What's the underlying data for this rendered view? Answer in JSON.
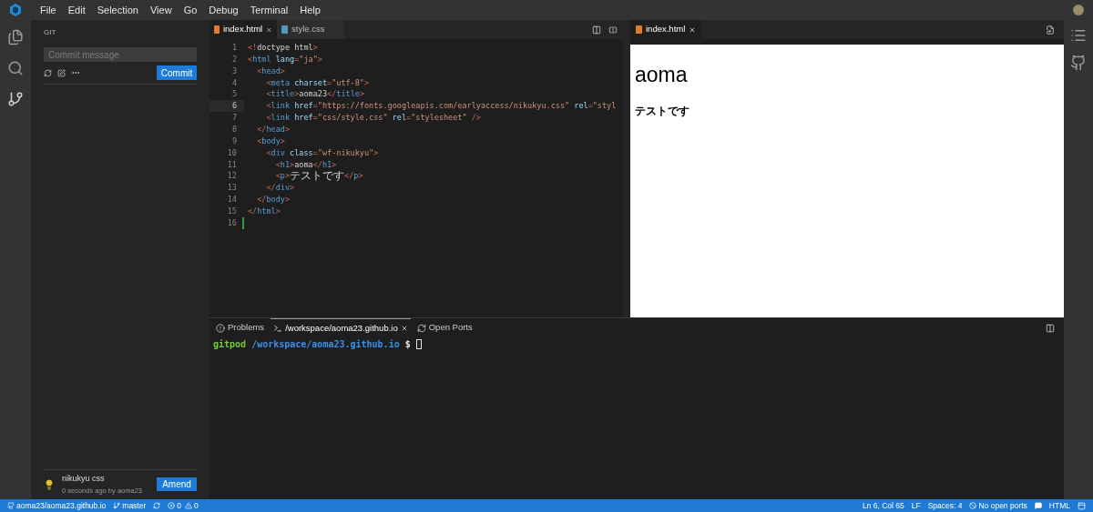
{
  "menu": [
    "File",
    "Edit",
    "Selection",
    "View",
    "Go",
    "Debug",
    "Terminal",
    "Help"
  ],
  "git": {
    "title": "GIT",
    "commit_placeholder": "Commit message",
    "commit_button": "Commit",
    "last_commit": {
      "message": "nikukyu css",
      "meta": "0 seconds ago by aoma23"
    },
    "amend_button": "Amend"
  },
  "editor_tabs": [
    {
      "label": "index.html",
      "selected": true,
      "kind": "html",
      "closable": true
    },
    {
      "label": "style.css",
      "selected": false,
      "kind": "css",
      "closable": false
    }
  ],
  "code_lines": [
    {
      "number": "1",
      "highlighted": false,
      "added": false,
      "tokens": [
        {
          "kind": "punct",
          "text": "<!"
        },
        {
          "kind": "plain",
          "text": "doctype html"
        },
        {
          "kind": "punct",
          "text": ">"
        }
      ]
    },
    {
      "number": "2",
      "highlighted": false,
      "added": false,
      "tokens": [
        {
          "kind": "punct",
          "text": "<"
        },
        {
          "kind": "tag",
          "text": "html "
        },
        {
          "kind": "attr",
          "text": "lang"
        },
        {
          "kind": "punct",
          "text": "="
        },
        {
          "kind": "str",
          "text": "\"ja\""
        },
        {
          "kind": "punct",
          "text": ">"
        }
      ]
    },
    {
      "number": "3",
      "highlighted": false,
      "added": false,
      "tokens": [
        {
          "kind": "punct",
          "text": "  <"
        },
        {
          "kind": "tag",
          "text": "head"
        },
        {
          "kind": "punct",
          "text": ">"
        }
      ]
    },
    {
      "number": "4",
      "highlighted": false,
      "added": false,
      "tokens": [
        {
          "kind": "punct",
          "text": "    <"
        },
        {
          "kind": "tag",
          "text": "meta "
        },
        {
          "kind": "attr",
          "text": "charset"
        },
        {
          "kind": "punct",
          "text": "="
        },
        {
          "kind": "str",
          "text": "\"utf-8\""
        },
        {
          "kind": "punct",
          "text": ">"
        }
      ]
    },
    {
      "number": "5",
      "highlighted": false,
      "added": false,
      "tokens": [
        {
          "kind": "punct",
          "text": "    <"
        },
        {
          "kind": "tag",
          "text": "title"
        },
        {
          "kind": "punct",
          "text": ">"
        },
        {
          "kind": "plain",
          "text": "aoma23"
        },
        {
          "kind": "punct",
          "text": "</"
        },
        {
          "kind": "tag",
          "text": "title"
        },
        {
          "kind": "punct",
          "text": ">"
        }
      ]
    },
    {
      "number": "6",
      "highlighted": true,
      "added": false,
      "tokens": [
        {
          "kind": "punct",
          "text": "    <"
        },
        {
          "kind": "tag",
          "text": "link "
        },
        {
          "kind": "attr",
          "text": "href"
        },
        {
          "kind": "punct",
          "text": "="
        },
        {
          "kind": "str",
          "text": "\"https://fonts.googleapis.com/earlyaccess/nikukyu.css\" "
        },
        {
          "kind": "attr",
          "text": "rel"
        },
        {
          "kind": "punct",
          "text": "="
        },
        {
          "kind": "str",
          "text": "\"styl"
        }
      ]
    },
    {
      "number": "7",
      "highlighted": false,
      "added": false,
      "tokens": [
        {
          "kind": "punct",
          "text": "    <"
        },
        {
          "kind": "tag",
          "text": "link "
        },
        {
          "kind": "attr",
          "text": "href"
        },
        {
          "kind": "punct",
          "text": "="
        },
        {
          "kind": "str",
          "text": "\"css/style.css\" "
        },
        {
          "kind": "attr",
          "text": "rel"
        },
        {
          "kind": "punct",
          "text": "="
        },
        {
          "kind": "str",
          "text": "\"stylesheet\" "
        },
        {
          "kind": "punct",
          "text": "/>"
        }
      ]
    },
    {
      "number": "8",
      "highlighted": false,
      "added": false,
      "tokens": [
        {
          "kind": "punct",
          "text": "  </"
        },
        {
          "kind": "tag",
          "text": "head"
        },
        {
          "kind": "punct",
          "text": ">"
        }
      ]
    },
    {
      "number": "9",
      "highlighted": false,
      "added": false,
      "tokens": [
        {
          "kind": "punct",
          "text": "  <"
        },
        {
          "kind": "tag",
          "text": "body"
        },
        {
          "kind": "punct",
          "text": ">"
        }
      ]
    },
    {
      "number": "10",
      "highlighted": false,
      "added": false,
      "tokens": [
        {
          "kind": "punct",
          "text": "    <"
        },
        {
          "kind": "tag",
          "text": "div "
        },
        {
          "kind": "attr",
          "text": "class"
        },
        {
          "kind": "punct",
          "text": "="
        },
        {
          "kind": "str",
          "text": "\"wf-nikukyu\""
        },
        {
          "kind": "punct",
          "text": ">"
        }
      ]
    },
    {
      "number": "11",
      "highlighted": false,
      "added": false,
      "tokens": [
        {
          "kind": "punct",
          "text": "      <"
        },
        {
          "kind": "tag",
          "text": "h1"
        },
        {
          "kind": "punct",
          "text": ">"
        },
        {
          "kind": "plain",
          "text": "aoma"
        },
        {
          "kind": "punct",
          "text": "</"
        },
        {
          "kind": "tag",
          "text": "h1"
        },
        {
          "kind": "punct",
          "text": ">"
        }
      ]
    },
    {
      "number": "12",
      "highlighted": false,
      "added": false,
      "tokens": [
        {
          "kind": "punct",
          "text": "      <"
        },
        {
          "kind": "tag",
          "text": "p"
        },
        {
          "kind": "punct",
          "text": ">"
        },
        {
          "kind": "cjk",
          "text": "テストです"
        },
        {
          "kind": "punct",
          "text": "</"
        },
        {
          "kind": "tag",
          "text": "p"
        },
        {
          "kind": "punct",
          "text": ">"
        }
      ]
    },
    {
      "number": "13",
      "highlighted": false,
      "added": false,
      "tokens": [
        {
          "kind": "punct",
          "text": "    </"
        },
        {
          "kind": "tag",
          "text": "div"
        },
        {
          "kind": "punct",
          "text": ">"
        }
      ]
    },
    {
      "number": "14",
      "highlighted": false,
      "added": false,
      "tokens": [
        {
          "kind": "punct",
          "text": "  </"
        },
        {
          "kind": "tag",
          "text": "body"
        },
        {
          "kind": "punct",
          "text": ">"
        }
      ]
    },
    {
      "number": "15",
      "highlighted": false,
      "added": false,
      "tokens": [
        {
          "kind": "punct",
          "text": "</"
        },
        {
          "kind": "tag",
          "text": "html"
        },
        {
          "kind": "punct",
          "text": ">"
        }
      ]
    },
    {
      "number": "16",
      "highlighted": false,
      "added": true
    }
  ],
  "preview": {
    "tab": "index.html",
    "heading": "aoma",
    "paragraph": "テストです"
  },
  "panel_tabs": [
    {
      "label": "Problems",
      "selected": false,
      "kind": "problems"
    },
    {
      "label": "/workspace/aoma23.github.io",
      "selected": true,
      "kind": "terminal"
    },
    {
      "label": "Open Ports",
      "selected": false,
      "kind": "ports"
    }
  ],
  "terminal": {
    "user": "gitpod",
    "path": "/workspace/aoma23.github.io",
    "prompt": "$"
  },
  "status_bar": {
    "repo": "aoma23/aoma23.github.io",
    "branch": "master",
    "errors": "0",
    "warnings": "0",
    "position": "Ln 6, Col 65",
    "eol": "LF",
    "spaces": "Spaces: 4",
    "ports": "No open ports",
    "language": "HTML"
  }
}
